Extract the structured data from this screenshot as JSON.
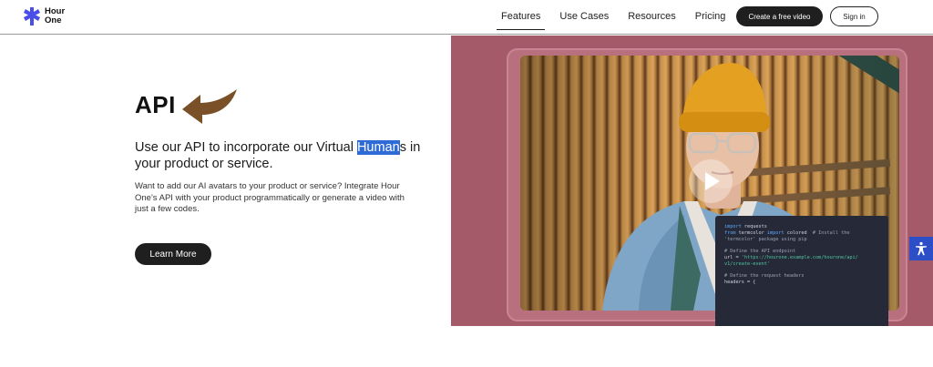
{
  "brand": {
    "name_line1": "Hour",
    "name_line2": "One",
    "color": "#4a4ee8"
  },
  "nav": {
    "items": [
      {
        "label": "Features",
        "active": true
      },
      {
        "label": "Use Cases",
        "active": false
      },
      {
        "label": "Resources",
        "active": false
      },
      {
        "label": "Pricing",
        "active": false
      }
    ],
    "create_label": "Create a free video",
    "signin_label": "Sign in"
  },
  "main": {
    "title": "API",
    "subtitle_before": "Use our API to incorporate our Virtual ",
    "subtitle_highlight": "Human",
    "subtitle_after": "s in your product or service.",
    "description": "Want to add our AI avatars to your product or service? Integrate Hour One's API with your product programmatically or generate a video with just a few codes.",
    "learn_more_label": "Learn More"
  },
  "code": {
    "lines": [
      [
        {
          "t": "import",
          "c": "kw"
        },
        {
          "t": " requests",
          "c": ""
        }
      ],
      [
        {
          "t": "from",
          "c": "kw"
        },
        {
          "t": " termcolor ",
          "c": ""
        },
        {
          "t": "import",
          "c": "kw"
        },
        {
          "t": " colored  ",
          "c": ""
        },
        {
          "t": "# Install the",
          "c": "cm"
        }
      ],
      [
        {
          "t": "'termcolor' package using pip",
          "c": "cm"
        }
      ],
      [],
      [
        {
          "t": "# Define the API endpoint",
          "c": "cm"
        }
      ],
      [
        {
          "t": "url = ",
          "c": ""
        },
        {
          "t": "'https://hourone.example.com/hourone/api/",
          "c": "st"
        }
      ],
      [
        {
          "t": "v1/create-event'",
          "c": "st"
        }
      ],
      [],
      [
        {
          "t": "# Define the request headers",
          "c": "cm"
        }
      ],
      [
        {
          "t": "headers = {",
          "c": ""
        }
      ]
    ]
  },
  "icons": {
    "play": "play-icon",
    "accessibility": "accessibility-icon",
    "arrow": "arrow-left-icon"
  },
  "colors": {
    "hero_bg": "#a45a68",
    "accessibility_bg": "#2c4fc8",
    "highlight": "#2f6bd6"
  }
}
